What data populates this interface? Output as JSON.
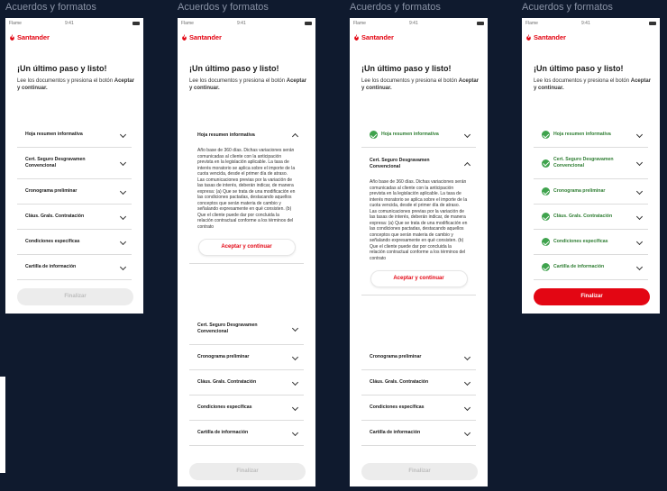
{
  "frames": [
    {
      "title": "Acuerdos y formatos",
      "carrier": "Flame",
      "time": "9:41",
      "brand": "Santander",
      "heading": "¡Un último paso y listo!",
      "desc_text": "Lee los documentos y presiona el botón",
      "desc_bold": "Aceptar y continuar.",
      "items": [
        "Hoja resumen informativa",
        "Cert. Seguro Desgravamen Convencional",
        "Cronograma preliminar",
        "Cláus. Grals. Contratación",
        "Condiciones específicas",
        "Cartilla de información"
      ],
      "final_label": "Finalizar"
    },
    {
      "title": "Acuerdos y formatos",
      "carrier": "Flame",
      "time": "9:41",
      "brand": "Santander",
      "heading": "¡Un último paso y listo!",
      "desc_text": "Lee los documentos y presiona el botón",
      "desc_bold": "Aceptar y continuar.",
      "expanded_label": "Hoja resumen informativa",
      "expanded_body": "Año base de 360 días. Dichas variaciones serán comunicadas al cliente con la anticipación prevista en la legislación aplicable. La tasa de interés moratorio se aplica sobre el importe de la cuota vencida, desde el primer día de atraso. Las comunicaciones previas por la variación de las tasas de interés, deberán indicar, de manera expresa: (a) Que se trata de una modificación en las condiciones pactadas, destacando aquellos conceptos que serán materia de cambio y señalando expresamente en qué consisten. (b) Que el cliente puede dar por concluida la relación contractual conforme a los términos del contrato",
      "accept_label": "Aceptar y continuar",
      "items": [
        "Cert. Seguro Desgravamen Convencional",
        "Cronograma preliminar",
        "Cláus. Grals. Contratación",
        "Condiciones específicas",
        "Cartilla de información"
      ],
      "final_label": "Finalizar"
    },
    {
      "title": "Acuerdos y formatos",
      "carrier": "Flame",
      "time": "9:41",
      "brand": "Santander",
      "heading": "¡Un último paso y listo!",
      "desc_text": "Lee los documentos y presiona el botón",
      "desc_bold": "Aceptar y continuar.",
      "done_items": [
        "Hoja resumen informativa"
      ],
      "expanded_label": "Cert. Seguro Desgravamen Convencional",
      "expanded_body": "Año base de 360 días. Dichas variaciones serán comunicadas al cliente con la anticipación prevista en la legislación aplicable. La tasa de interés moratorio se aplica sobre el importe de la cuota vencida, desde el primer día de atraso. Las comunicaciones previas por la variación de las tasas de interés, deberán indicar, de manera expresa: (a) Que se trata de una modificación en las condiciones pactadas, destacando aquellos conceptos que serán materia de cambio y señalando expresamente en qué consisten. (b) Que el cliente puede dar por concluida la relación contractual conforme a los términos del contrato",
      "accept_label": "Aceptar y continuar",
      "items": [
        "Cronograma preliminar",
        "Cláus. Grals. Contratación",
        "Condiciones específicas",
        "Cartilla de información"
      ],
      "final_label": "Finalizar"
    },
    {
      "title": "Acuerdos y formatos",
      "carrier": "Flame",
      "time": "9:41",
      "brand": "Santander",
      "heading": "¡Un último paso y listo!",
      "desc_text": "Lee los documentos y presiona el botón",
      "desc_bold": "Aceptar y continuar.",
      "done_items": [
        "Hoja resumen informativa",
        "Cert. Seguro Desgravamen Convencional",
        "Cronograma preliminar",
        "Cláus. Grals. Contratación",
        "Condiciones específicas",
        "Cartilla de información"
      ],
      "final_label": "Finalizar"
    }
  ],
  "colors": {
    "brand_red": "#e30613",
    "success_green": "#3fa34d",
    "background": "#0f1a2e"
  },
  "icons": {
    "logo": "santander-flame-icon",
    "chevron": "chevron-icon",
    "check": "check-circle-icon"
  }
}
